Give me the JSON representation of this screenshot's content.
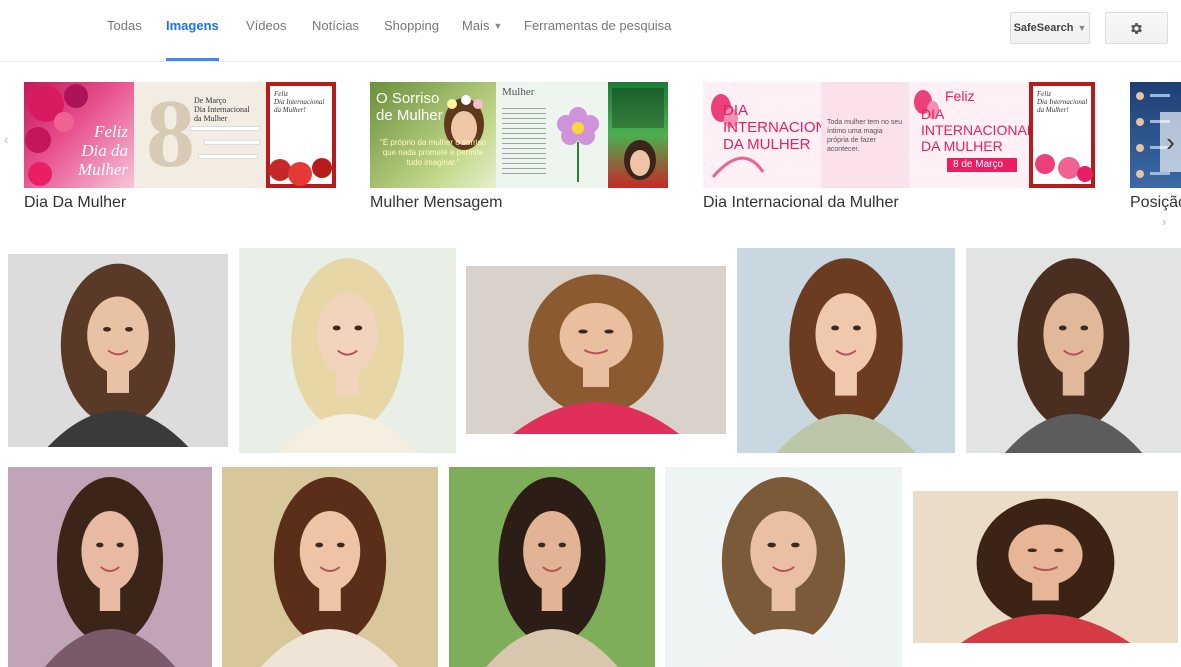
{
  "nav": {
    "tabs": [
      {
        "label": "Todas"
      },
      {
        "label": "Imagens",
        "active": true
      },
      {
        "label": "Vídeos"
      },
      {
        "label": "Notícias"
      },
      {
        "label": "Shopping"
      },
      {
        "label": "Mais",
        "dropdown": true
      },
      {
        "label": "Ferramentas de pesquisa"
      }
    ],
    "safesearch_label": "SafeSearch",
    "settings_icon": "gear-icon",
    "accent_color": "#4285f4"
  },
  "related": {
    "cards": [
      {
        "label": "Dia Da Mulher",
        "thumb_texts": {
          "feliz": "Feliz\nDia da\nMulher",
          "eight": "8",
          "marco": "De Março\nDia Internacional\nda Mulher",
          "feliz2": "Feliz\nDia Internacional\nda Mulher!"
        }
      },
      {
        "label": "Mulher Mensagem",
        "thumb_texts": {
          "sorriso": "O Sorriso\nde Mulher",
          "quote": "\"É próprio da mulher o sorriso que nada promete e permite tudo imaginar.\"",
          "mulher": "Mulher"
        }
      },
      {
        "label": "Dia Internacional da Mulher",
        "thumb_texts": {
          "dia1": "DIA\nINTERNACIONAL\nDA MULHER",
          "msg": "Toda mulher tem no seu íntimo uma magia própria de fazer acontecer.",
          "feliz": "Feliz",
          "dia2": "DIA\nINTERNACIONAL\nDA MULHER",
          "date": "8 de Março",
          "feliz3": "Feliz\nDia Internacional\nda Mulher!"
        }
      },
      {
        "label": "Posição"
      }
    ],
    "next_icon": "chevron-right-icon",
    "prev_icon": "chevron-left-icon"
  },
  "results": {
    "rows": [
      [
        {
          "bg": "#dcdcdc",
          "hair": "#5a3a26",
          "skin": "#e9c2a6",
          "shirt": "#3a3a3a"
        },
        {
          "bg": "#e9efe6",
          "hair": "#e8d7a6",
          "skin": "#f2d4bd",
          "shirt": "#f5efe2"
        },
        {
          "bg": "#d8d2ca",
          "hair": "#8c5a30",
          "skin": "#e9bfa0",
          "shirt": "#e0305a"
        },
        {
          "bg": "#c9d7e0",
          "hair": "#6b3c1f",
          "skin": "#efc8ad",
          "shirt": "#bcc6a8"
        },
        {
          "bg": "#e1e4e2",
          "hair": "#4a2e1f",
          "skin": "#e2b89a",
          "shirt": "#5c5c5c"
        }
      ],
      [
        {
          "bg": "#c0a5b8",
          "hair": "#3b2418",
          "skin": "#e8b9a3",
          "shirt": "#7a5a6a"
        },
        {
          "bg": "#d7c79a",
          "hair": "#5a2e18",
          "skin": "#eec3a6",
          "shirt": "#efe4d6"
        },
        {
          "bg": "#7fae5a",
          "hair": "#2c1e16",
          "skin": "#e2b495",
          "shirt": "#d8c6ad"
        },
        {
          "bg": "#eef3f4",
          "hair": "#7b5a3a",
          "skin": "#e9c0a4",
          "shirt": "#f2f2f2"
        },
        {
          "bg": "#ebdcc8",
          "hair": "#3d2216",
          "skin": "#e6b697",
          "shirt": "#d43b45"
        }
      ]
    ]
  }
}
